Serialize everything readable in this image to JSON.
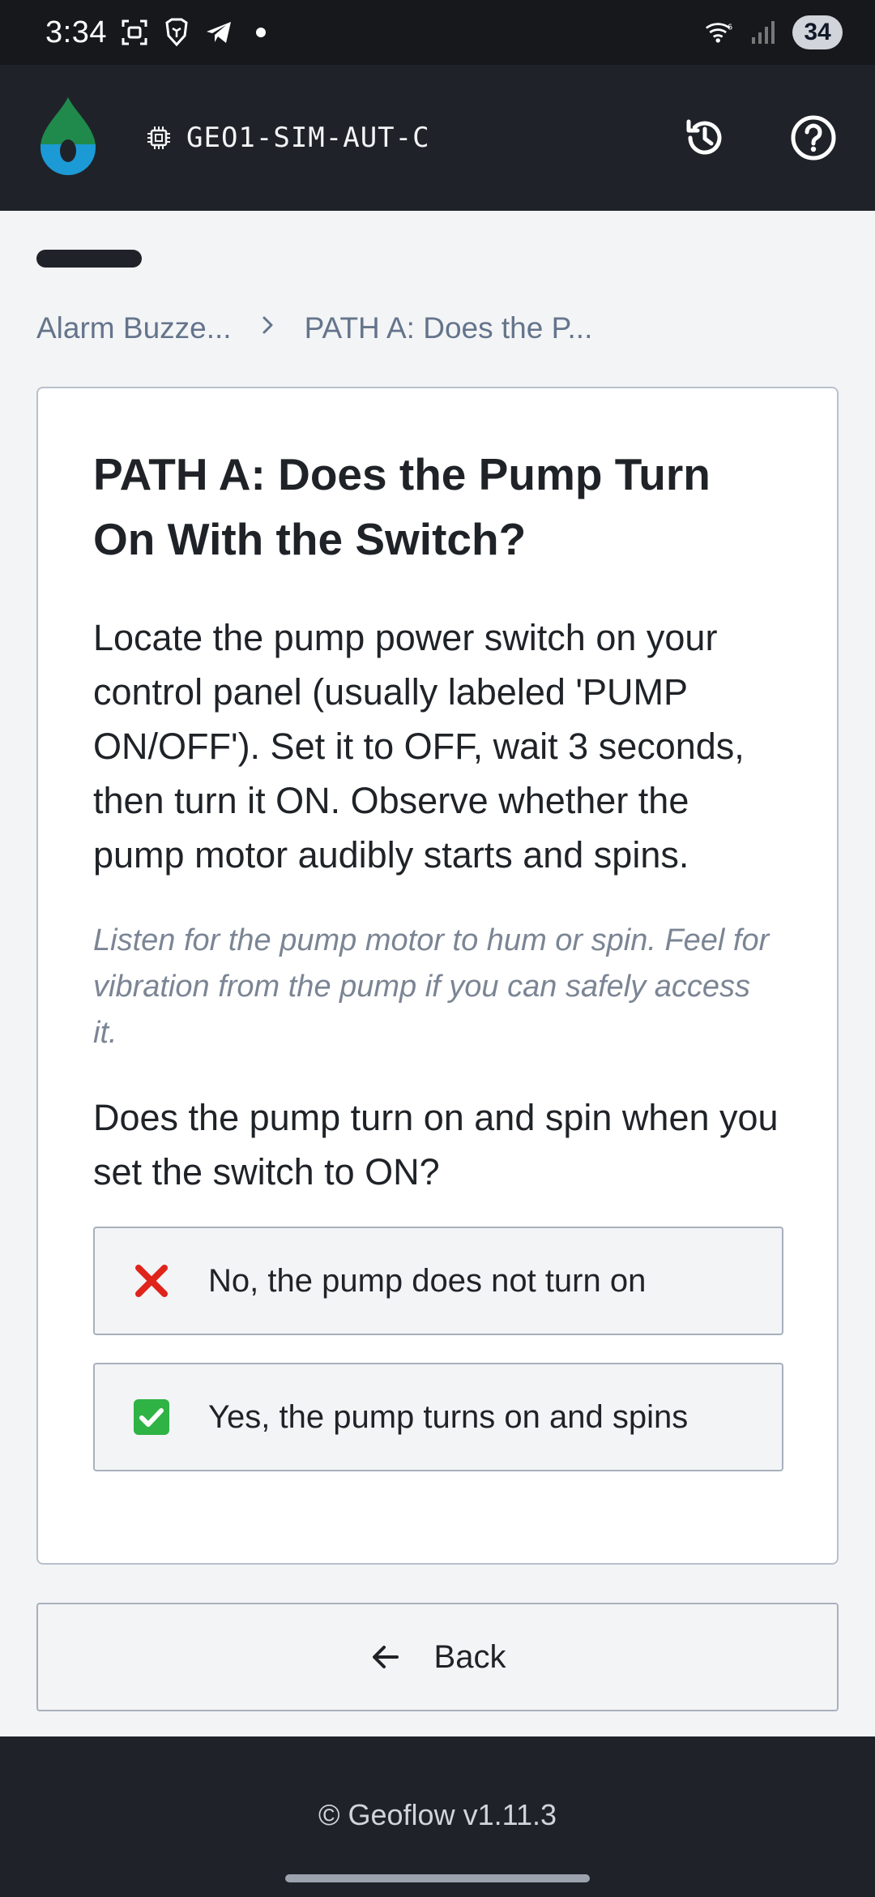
{
  "status_bar": {
    "time": "3:34",
    "battery": "34",
    "icons": [
      "screenshot-icon",
      "brave-icon",
      "telegram-icon",
      "dot-icon",
      "wifi-icon",
      "signal-icon"
    ]
  },
  "header": {
    "device_id": "GEO1-SIM-AUT-C",
    "icons": [
      "geoflow-logo",
      "chip-icon",
      "history-icon",
      "help-icon"
    ]
  },
  "breadcrumb": {
    "items": [
      "Alarm Buzze...",
      "PATH A: Does the P..."
    ],
    "separator": "›"
  },
  "card": {
    "title": "PATH A: Does the Pump Turn On With the Switch?",
    "body": "Locate the pump power switch on your control panel (usually labeled 'PUMP ON/OFF'). Set it to OFF, wait 3 seconds, then turn it ON. Observe whether the pump motor audibly starts and spins.",
    "hint": "Listen for the pump motor to hum or spin. Feel for vibration from the pump if you can safely access it.",
    "question": "Does the pump turn on and spin when you set the switch to ON?",
    "answers": [
      {
        "label": "No, the pump does not turn on",
        "icon": "cross-mark-icon"
      },
      {
        "label": "Yes, the pump turns on and spins",
        "icon": "check-mark-icon"
      }
    ]
  },
  "back_button": {
    "label": "Back",
    "icon": "arrow-left-icon"
  },
  "footer": {
    "text": "© Geoflow v1.11.3"
  },
  "colors": {
    "header_bg": "#1f2329",
    "logo_green": "#1f8a4c",
    "logo_blue": "#1c9ad6",
    "muted_text": "#64748b",
    "cross_red": "#e0241b",
    "check_green": "#2fb344"
  }
}
